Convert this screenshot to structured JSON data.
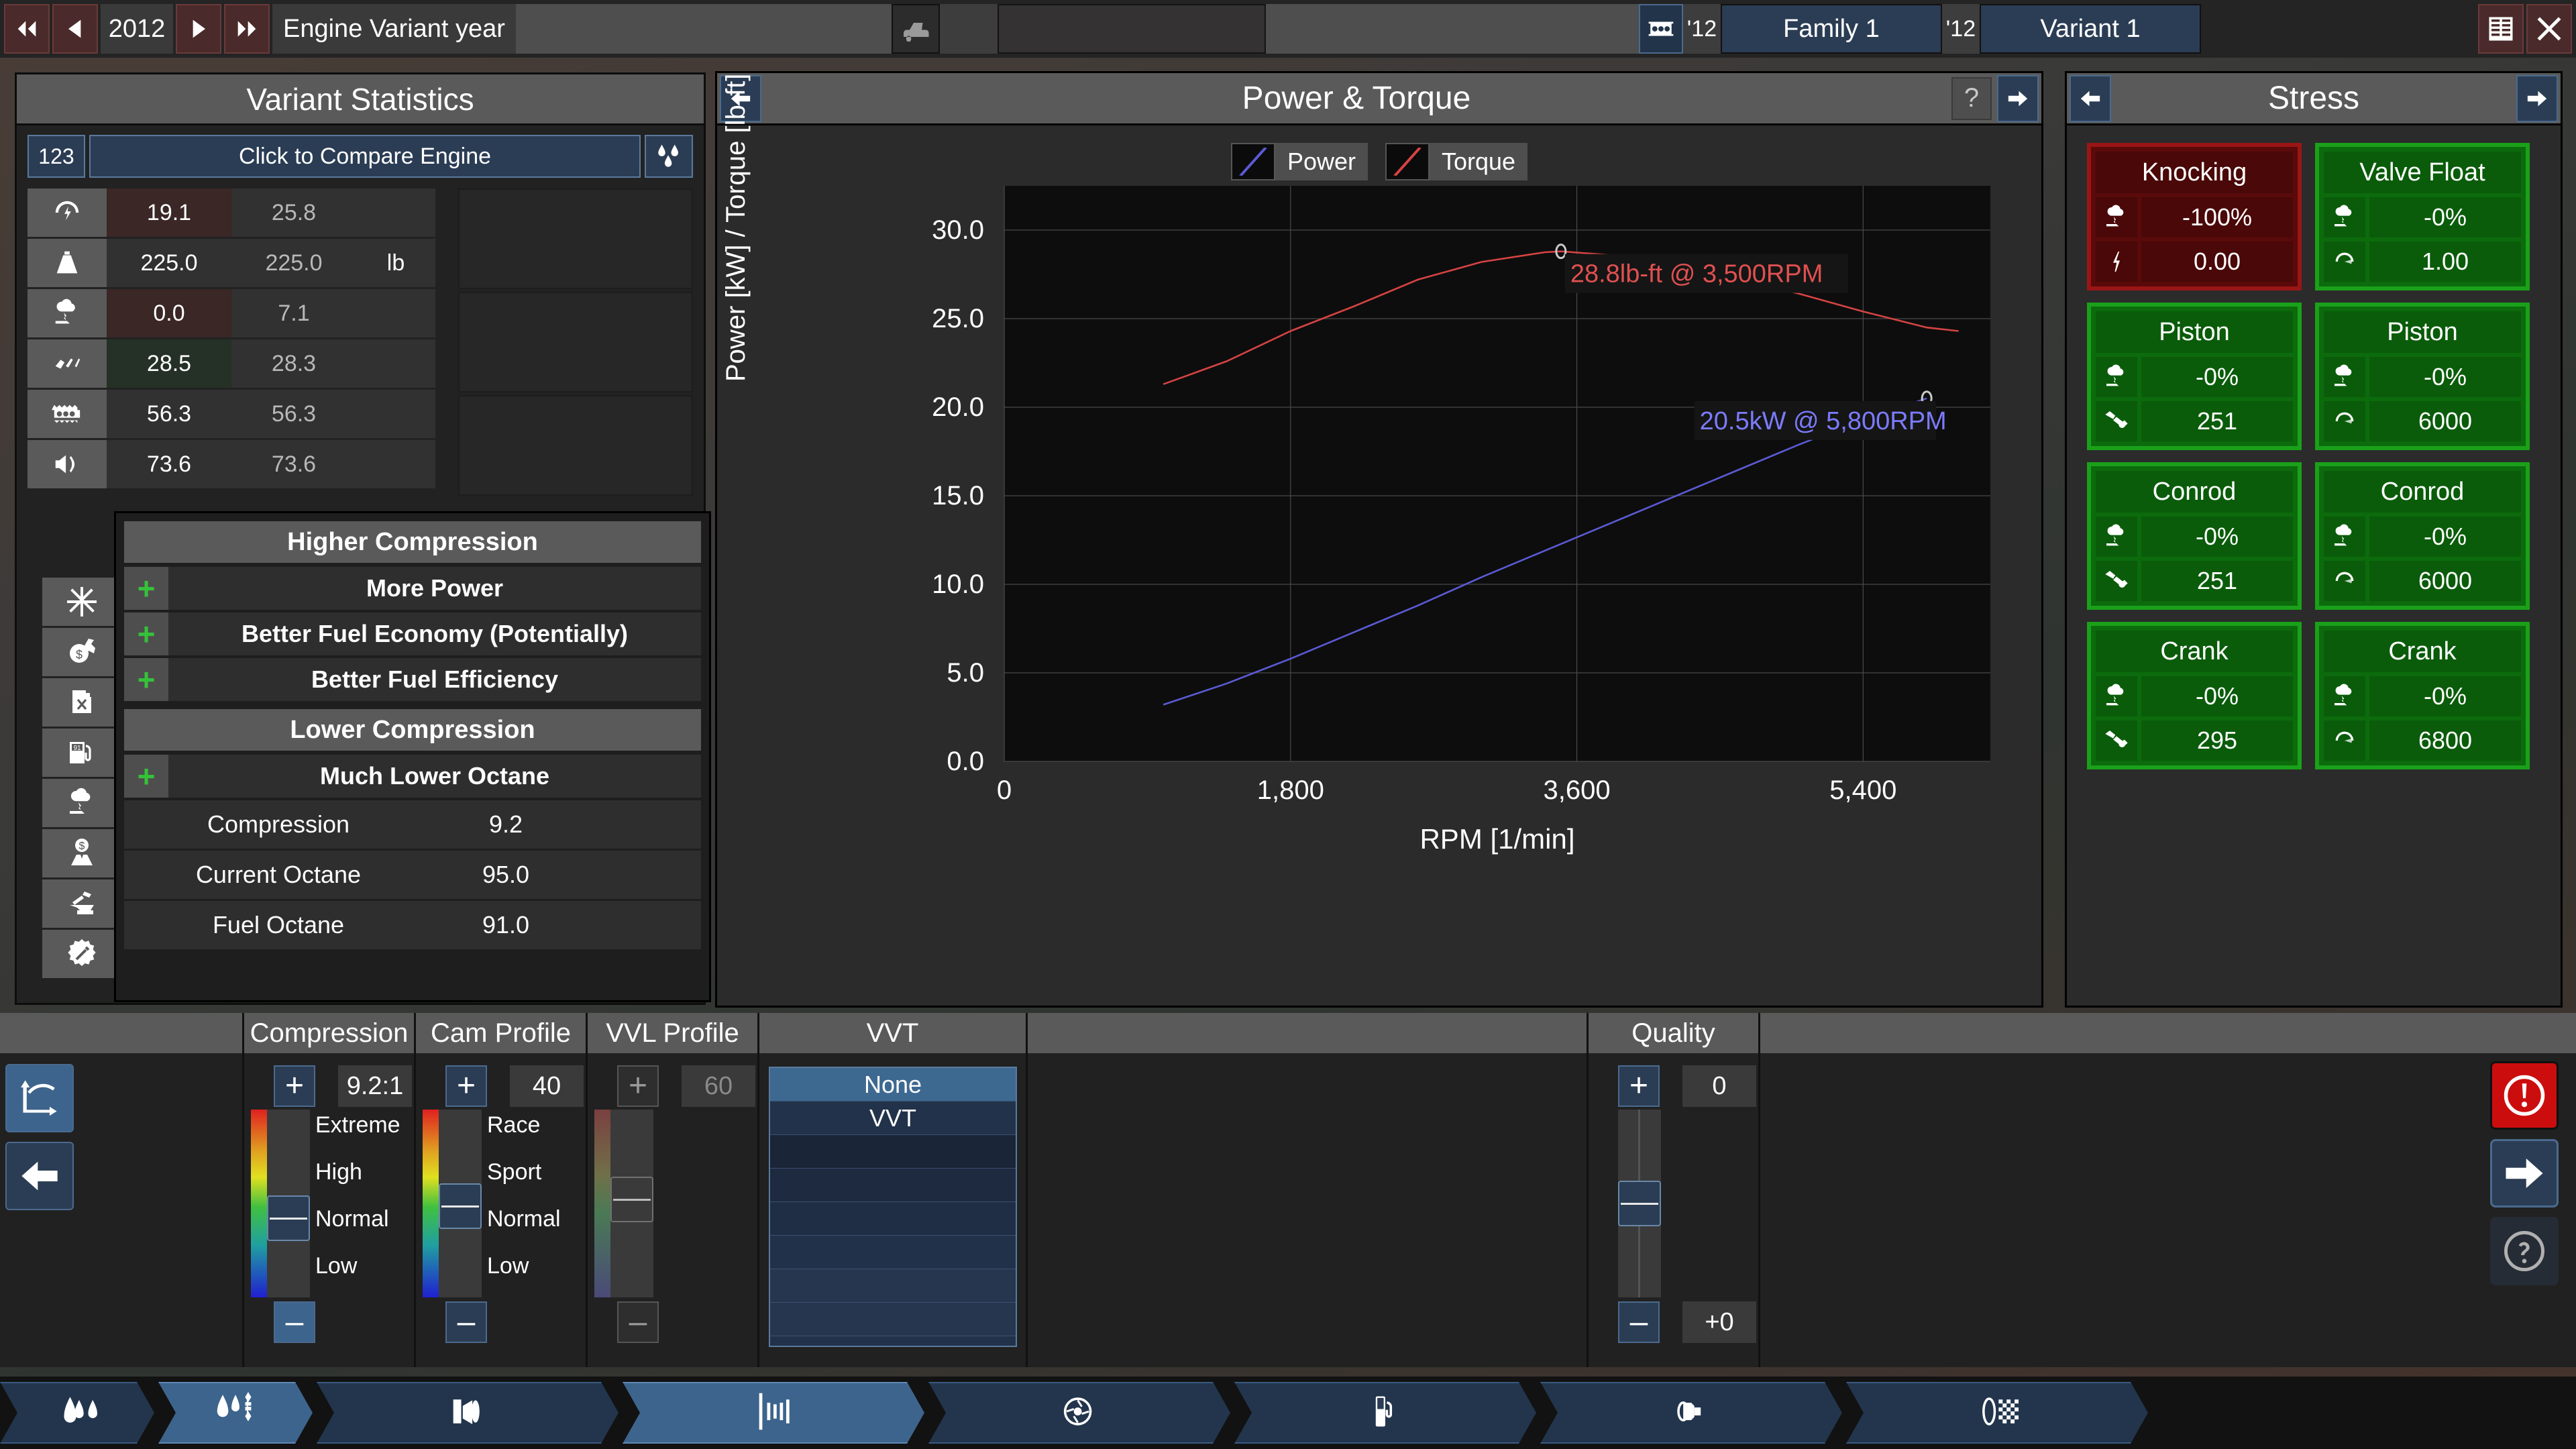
{
  "topbar": {
    "year": "2012",
    "label": "Engine Variant year",
    "family_year": "'12",
    "family_name": "Family 1",
    "variant_year": "'12",
    "variant_name": "Variant 1",
    "icons": {
      "first": "skip-backward-icon",
      "prev": "step-backward-icon",
      "next": "step-forward-icon",
      "last": "skip-forward-icon",
      "car": "car-icon",
      "engine": "engine-block-icon",
      "report": "report-table-icon",
      "close": "close-x-icon"
    }
  },
  "left_panel": {
    "title": "Variant Statistics",
    "compare": {
      "number": "123",
      "label": "Click to Compare Engine",
      "icon": "droplets-icon"
    },
    "rows": [
      {
        "icon": "performance-gauge-icon",
        "current": "19.1",
        "previous": "25.8",
        "unit": "",
        "state": "bad"
      },
      {
        "icon": "weight-icon",
        "current": "225.0",
        "previous": "225.0",
        "unit": "lb",
        "state": "neutral"
      },
      {
        "icon": "emissions-icon",
        "current": "0.0",
        "previous": "7.1",
        "unit": "",
        "state": "bad"
      },
      {
        "icon": "smoothness-icon",
        "current": "28.5",
        "previous": "28.3",
        "unit": "",
        "state": "good"
      },
      {
        "icon": "engine-block-icon",
        "current": "56.3",
        "previous": "56.3",
        "unit": "",
        "state": "neutral"
      },
      {
        "icon": "loudness-icon",
        "current": "73.6",
        "previous": "73.6",
        "unit": "",
        "state": "neutral"
      }
    ],
    "hidden_rows": [
      {
        "icon": "snowflake-icon",
        "state": "good"
      },
      {
        "icon": "service-cost-icon",
        "state": "neutral"
      },
      {
        "icon": "fuel-can-icon",
        "state": "bad"
      },
      {
        "icon": "fuel-pump-91-icon",
        "state": "bad"
      },
      {
        "icon": "emissions-icon",
        "state": "bad"
      },
      {
        "icon": "engineer-cost-icon",
        "state": "neutral"
      },
      {
        "icon": "anvil-hammer-icon",
        "state": "neutral"
      },
      {
        "icon": "gear-wrench-icon",
        "state": "neutral"
      }
    ]
  },
  "tooltip": {
    "higher_header": "Higher Compression",
    "higher_items": [
      "More Power",
      "Better Fuel Economy (Potentially)",
      "Better Fuel Efficiency"
    ],
    "lower_header": "Lower Compression",
    "lower_items": [
      "Much Lower Octane"
    ],
    "table": [
      {
        "label": "Compression",
        "value": "9.2"
      },
      {
        "label": "Current Octane",
        "value": "95.0"
      },
      {
        "label": "Fuel Octane",
        "value": "91.0"
      }
    ]
  },
  "chart_panel": {
    "title": "Power & Torque",
    "prev_icon": "arrow-left-icon",
    "next_icon": "arrow-right-icon",
    "help_icon": "question-mark-icon"
  },
  "chart_data": {
    "type": "line",
    "title": "Power & Torque",
    "xlabel": "RPM [1/min]",
    "ylabel": "Power [kW] / Torque [lb-ft]",
    "xlim": [
      0,
      6200
    ],
    "ylim": [
      0,
      32.5
    ],
    "xticks": [
      0,
      1800,
      3600,
      5400
    ],
    "xticklabels": [
      "0",
      "1,800",
      "3,600",
      "5,400"
    ],
    "yticks": [
      0,
      5,
      10,
      15,
      20,
      25,
      30
    ],
    "yticklabels": [
      "0.0",
      "5.0",
      "10.0",
      "15.0",
      "20.0",
      "25.0",
      "30.0"
    ],
    "grid": true,
    "legend_position": "top-center",
    "series": [
      {
        "name": "Power",
        "color": "#5b5bd6",
        "unit": "kW",
        "x": [
          1000,
          1400,
          1800,
          2200,
          2600,
          3000,
          3400,
          3800,
          4200,
          4600,
          5000,
          5400,
          5800
        ],
        "y": [
          3.2,
          4.4,
          5.8,
          7.3,
          8.8,
          10.4,
          11.9,
          13.4,
          14.9,
          16.4,
          17.9,
          19.3,
          20.5
        ],
        "marker_label": "20.5kW @ 5,800RPM",
        "marker_x": 5800,
        "marker_y": 20.5
      },
      {
        "name": "Torque",
        "color": "#d64343",
        "unit": "lb-ft",
        "x": [
          1000,
          1400,
          1800,
          2200,
          2600,
          3000,
          3400,
          3500,
          3800,
          4200,
          4600,
          5000,
          5400,
          5800,
          6000
        ],
        "y": [
          21.3,
          22.6,
          24.3,
          25.7,
          27.2,
          28.2,
          28.75,
          28.8,
          28.6,
          28.1,
          27.3,
          26.4,
          25.4,
          24.5,
          24.3
        ],
        "marker_label": "28.8lb-ft @ 3,500RPM",
        "marker_x": 3500,
        "marker_y": 28.8
      }
    ]
  },
  "stress_panel": {
    "title": "Stress",
    "prev_icon": "arrow-left-icon",
    "next_icon": "arrow-right-icon",
    "cards": [
      {
        "title": "Knocking",
        "state": "red",
        "row1_icon": "emissions-icon",
        "row1_value": "-100%",
        "row2_icon": "lightning-icon",
        "row2_value": "0.00"
      },
      {
        "title": "Valve Float",
        "state": "green",
        "row1_icon": "emissions-icon",
        "row1_value": "-0%",
        "row2_icon": "gauge-icon",
        "row2_value": "1.00"
      },
      {
        "title": "Piston",
        "state": "green",
        "row1_icon": "emissions-icon",
        "row1_value": "-0%",
        "row2_icon": "wrench-icon",
        "row2_value": "251"
      },
      {
        "title": "Piston",
        "state": "green",
        "row1_icon": "emissions-icon",
        "row1_value": "-0%",
        "row2_icon": "gauge-icon",
        "row2_value": "6000"
      },
      {
        "title": "Conrod",
        "state": "green",
        "row1_icon": "emissions-icon",
        "row1_value": "-0%",
        "row2_icon": "wrench-icon",
        "row2_value": "251"
      },
      {
        "title": "Conrod",
        "state": "green",
        "row1_icon": "emissions-icon",
        "row1_value": "-0%",
        "row2_icon": "gauge-icon",
        "row2_value": "6000"
      },
      {
        "title": "Crank",
        "state": "green",
        "row1_icon": "emissions-icon",
        "row1_value": "-0%",
        "row2_icon": "wrench-icon",
        "row2_value": "295"
      },
      {
        "title": "Crank",
        "state": "green",
        "row1_icon": "emissions-icon",
        "row1_value": "-0%",
        "row2_icon": "gauge-icon",
        "row2_value": "6800"
      }
    ]
  },
  "bottom": {
    "graph_button_icon": "curve-graph-icon",
    "back_button_icon": "arrow-left-icon",
    "compression": {
      "title": "Compression",
      "plus": "+",
      "minus": "–",
      "value": "9.2:1",
      "ticks": [
        "Extreme",
        "High",
        "Normal",
        "Low"
      ]
    },
    "cam_profile": {
      "title": "Cam Profile",
      "plus": "+",
      "minus": "–",
      "value": "40",
      "ticks": [
        "Race",
        "Sport",
        "Normal",
        "Low"
      ]
    },
    "vvl_profile": {
      "title": "VVL Profile",
      "plus": "+",
      "minus": "–",
      "value": "60",
      "ticks": []
    },
    "vvt": {
      "title": "VVT",
      "options": [
        "None",
        "VVT"
      ],
      "selected": "None"
    },
    "quality": {
      "title": "Quality",
      "plus": "+",
      "minus": "–",
      "value": "0",
      "delta": "+0"
    },
    "warning_icon": "warning-exclamation-icon",
    "forward_icon": "arrow-right-icon",
    "help_icon": "question-mark-icon"
  },
  "bottom_nav": {
    "tabs": [
      {
        "icon": "engine-bottom-end-icon",
        "active": false
      },
      {
        "icon": "engine-top-end-icon",
        "active": true
      },
      {
        "icon": "piston-conrod-icon",
        "active": false
      },
      {
        "icon": "crankshaft-icon",
        "active": true
      },
      {
        "icon": "turbo-icon",
        "active": false
      },
      {
        "icon": "fuel-system-icon",
        "active": false
      },
      {
        "icon": "exhaust-icon",
        "active": false
      },
      {
        "icon": "dyno-result-icon",
        "active": false
      }
    ]
  }
}
